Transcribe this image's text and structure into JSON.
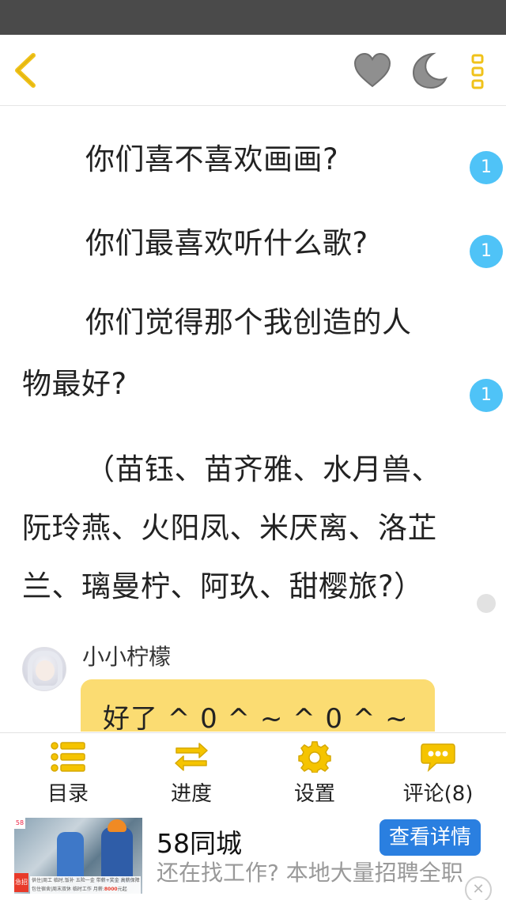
{
  "reader": {
    "paragraphs": [
      [
        "你们喜不喜欢画画?"
      ],
      [
        "你们最喜欢听什么歌?"
      ],
      [
        "你们觉得那个我创造的人",
        "物最好?"
      ],
      [
        "（苗钰、苗齐雅、水月兽、",
        "阮玲燕、火阳凤、米厌离、洛芷",
        "兰、璃曼柠、阿玖、甜樱旅?）"
      ]
    ],
    "comment_badges": [
      "1",
      "1",
      "1",
      ""
    ]
  },
  "comment": {
    "author": "小小柠檬",
    "text": "好了 ^ 0 ^ ~ ^ 0 ^ ~"
  },
  "top_bar": {
    "icons": [
      "chevron-left-icon",
      "heart-icon",
      "moon-icon",
      "more-vertical-icon"
    ]
  },
  "bottom_nav": [
    {
      "label": "目录",
      "icon": "list-icon"
    },
    {
      "label": "进度",
      "icon": "swap-arrows-icon"
    },
    {
      "label": "设置",
      "icon": "gear-icon"
    },
    {
      "label": "评论(8)",
      "icon": "chat-bubble-icon"
    }
  ],
  "ad": {
    "title": "58同城",
    "cta": "查看详情",
    "description": "还在找工作? 本地大量招聘全职",
    "image_logo": "58",
    "image_tag": "急招",
    "image_caption_line1": "供住|周工 临时,饭补 五险一金 带薪+奖金 高薪保障",
    "image_caption_line2": "包住宿舍|周末双休 临时工作 月薪:",
    "image_caption_salary": "8000",
    "image_caption_unit": "元起"
  },
  "colors": {
    "accent_yellow": "#f5c400",
    "badge_blue": "#4fc3f7",
    "bubble_yellow": "#fbdc72",
    "cta_blue": "#2a7fe0",
    "status_bar": "#4a4a4a"
  }
}
